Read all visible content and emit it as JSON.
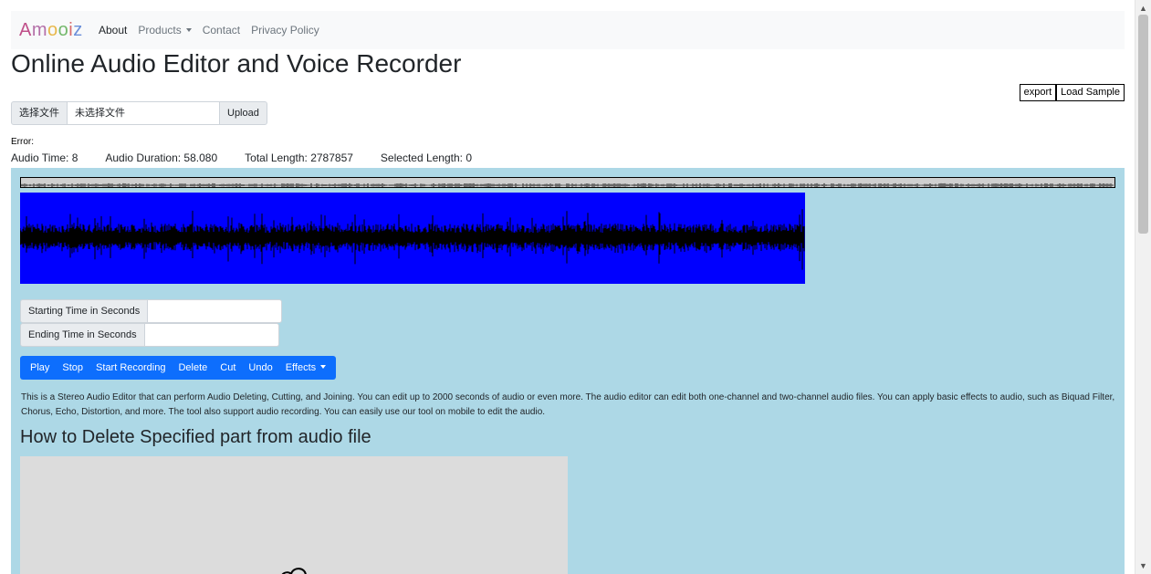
{
  "brand": {
    "letters": [
      "A",
      "m",
      "o",
      "o",
      "i",
      "z"
    ]
  },
  "nav": {
    "about": "About",
    "products": "Products",
    "contact": "Contact",
    "privacy": "Privacy Policy"
  },
  "page_title": "Online Audio Editor and Voice Recorder",
  "top_buttons": {
    "export": "export",
    "load_sample": "Load Sample"
  },
  "file": {
    "choose": "选择文件",
    "name": "未选择文件",
    "upload": "Upload"
  },
  "error_label": "Error:",
  "stats": {
    "audio_time": "Audio Time: 8",
    "audio_duration": "Audio Duration: 58.080",
    "total_length": "Total Length: 2787857",
    "selected_length": "Selected Length: 0"
  },
  "time_fields": {
    "start_label": "Starting Time in Seconds",
    "start_value": "",
    "end_label": "Ending Time in Seconds",
    "end_value": ""
  },
  "toolbar": {
    "play": "Play",
    "stop": "Stop",
    "record": "Start Recording",
    "delete": "Delete",
    "cut": "Cut",
    "undo": "Undo",
    "effects": "Effects"
  },
  "description": "This is a Stereo Audio Editor that can perform Audio Deleting, Cutting, and Joining. You can edit up to 2000 seconds of audio or even more. The audio editor can edit both one-channel and two-channel audio files. You can apply basic effects to audio, such as Biquad Filter, Chorus, Echo, Distortion, and more. The tool also support audio recording. You can easily use our tool on mobile to edit the audio.",
  "section_heading": "How to Delete Specified part from audio file",
  "colors": {
    "panel_bg": "#add8e6",
    "wave_bg": "#0000ff",
    "toolbar_bg": "#0d6efd",
    "navbar_bg": "#f8f9fa"
  }
}
